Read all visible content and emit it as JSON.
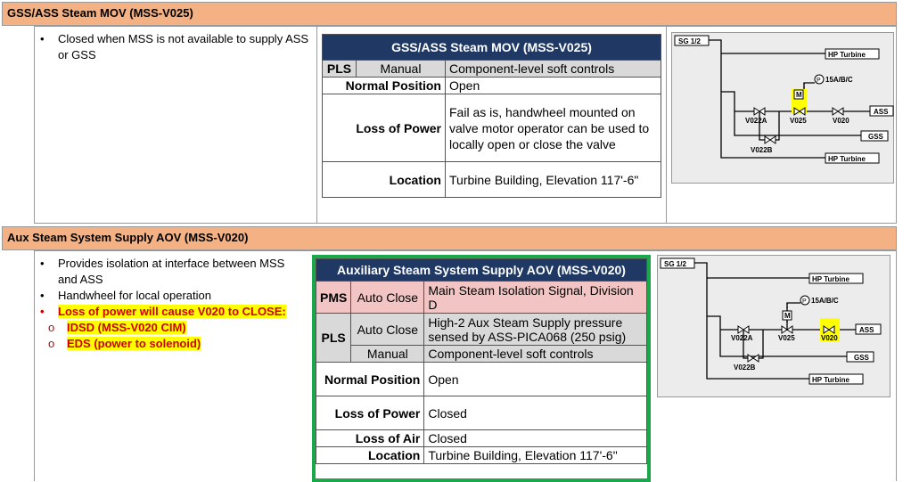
{
  "sec1": {
    "header": "GSS/ASS Steam MOV (MSS-V025)",
    "bullets": [
      "Closed when MSS is not available to supply ASS or GSS"
    ],
    "table": {
      "title": "GSS/ASS Steam MOV (MSS-V025)",
      "pls_label": "PLS",
      "pls_mode": "Manual",
      "pls_value": "Component-level soft controls",
      "rows": [
        {
          "label": "Normal Position",
          "value": "Open"
        },
        {
          "label": "Loss of Power",
          "value": "Fail as is, handwheel mounted on valve motor operator can be used to locally open or close the valve"
        },
        {
          "label": "Location",
          "value": "Turbine Building, Elevation 117'-6\""
        }
      ]
    },
    "diagram": {
      "sg": "SG 1/2",
      "hp_top": "HP Turbine",
      "p": "P",
      "p_label": "15A/B/C",
      "m": "M",
      "v022a": "V022A",
      "v025": "V025",
      "v020": "V020",
      "ass": "ASS",
      "gss": "GSS",
      "v022b": "V022B",
      "hp_bottom": "HP Turbine",
      "highlight": "V025"
    }
  },
  "sec2": {
    "header": "Aux Steam System Supply AOV (MSS-V020)",
    "bullets": [
      "Provides isolation at interface between MSS and ASS",
      "Handwheel for local operation"
    ],
    "red_bullet": "Loss of power will cause V020 to CLOSE:",
    "sub_bullets": [
      "IDSD (MSS-V020 CIM)",
      "EDS (power to solenoid)"
    ],
    "table": {
      "title": "Auxiliary Steam System Supply AOV (MSS-V020)",
      "pms_label": "PMS",
      "pms_mode": "Auto Close",
      "pms_value": "Main Steam Isolation Signal, Division D",
      "pls_label": "PLS",
      "pls_mode1": "Auto Close",
      "pls_value1": "High-2 Aux Steam Supply pressure sensed by ASS-PICA068 (250 psig)",
      "pls_mode2": "Manual",
      "pls_value2": "Component-level soft controls",
      "rows": [
        {
          "label": "Normal Position",
          "value": "Open"
        },
        {
          "label": "Loss of Power",
          "value": "Closed"
        },
        {
          "label": "Loss of Air",
          "value": "Closed"
        },
        {
          "label": "Location",
          "value": "Turbine Building, Elevation 117'-6\""
        }
      ]
    },
    "diagram": {
      "sg": "SG 1/2",
      "hp_top": "HP Turbine",
      "p": "P",
      "p_label": "15A/B/C",
      "m": "M",
      "v022a": "V022A",
      "v025": "V025",
      "v020": "V020",
      "ass": "ASS",
      "gss": "GSS",
      "v022b": "V022B",
      "hp_bottom": "HP Turbine",
      "highlight": "V020"
    }
  },
  "colors": {
    "header_bg": "#f4b183",
    "table_title_bg": "#1f3864",
    "highlight": "#ffff00",
    "red": "#d00000",
    "green_border": "#1aa84a"
  }
}
